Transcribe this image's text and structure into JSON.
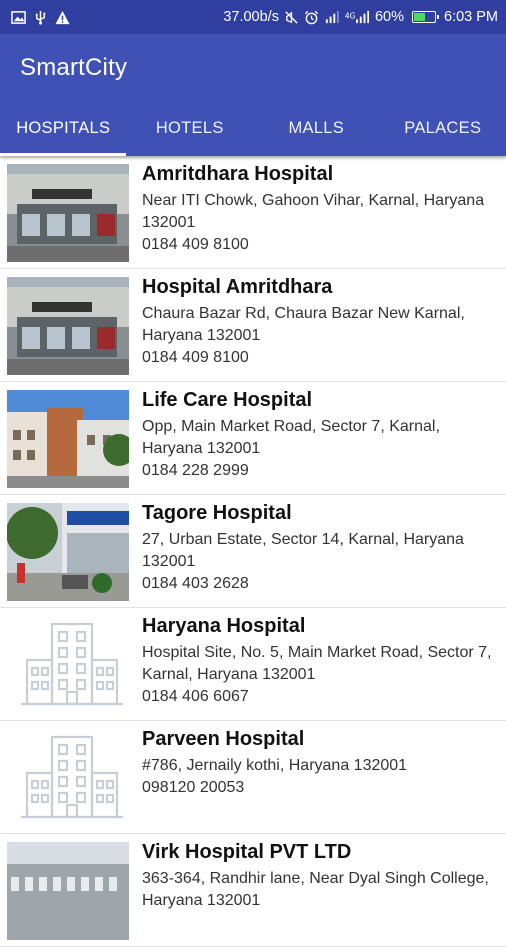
{
  "status_bar": {
    "left_icons": [
      "image-icon",
      "usb-icon",
      "warning-icon"
    ],
    "network_speed": "37.00b/s",
    "right_icons": [
      "mute-icon",
      "alarm-icon",
      "signal-icon",
      "signal-4g-icon"
    ],
    "battery_percent": "60%",
    "battery_level": 0.6,
    "time": "6:03 PM"
  },
  "app_bar": {
    "title": "SmartCity"
  },
  "tabs": [
    {
      "label": "HOSPITALS",
      "active": true
    },
    {
      "label": "HOTELS",
      "active": false
    },
    {
      "label": "MALLS",
      "active": false
    },
    {
      "label": "PALACES",
      "active": false
    }
  ],
  "hospitals": [
    {
      "name": "Amritdhara Hospital",
      "address": "Near ITI Chowk, Gahoon Vihar, Karnal, Haryana 132001",
      "phone": "0184 409 8100",
      "image": "building-photo"
    },
    {
      "name": "Hospital Amritdhara",
      "address": "Chaura Bazar Rd, Chaura Bazar New Karnal, Haryana 132001",
      "phone": "0184 409 8100",
      "image": "building-photo"
    },
    {
      "name": "Life Care Hospital",
      "address": "Opp, Main Market Road, Sector 7, Karnal, Haryana 132001",
      "phone": "0184 228 2999",
      "image": "building-photo"
    },
    {
      "name": "Tagore Hospital",
      "address": "27, Urban Estate, Sector 14, Karnal, Haryana 132001",
      "phone": "0184 403 2628",
      "image": "building-photo"
    },
    {
      "name": "Haryana Hospital",
      "address": "Hospital Site, No. 5, Main Market Road, Sector 7, Karnal, Haryana 132001",
      "phone": "0184 406 6067",
      "image": "building-placeholder-icon"
    },
    {
      "name": "Parveen Hospital",
      "address": "#786, Jernaily kothi, Haryana 132001",
      "phone": "098120 20053",
      "image": "building-placeholder-icon"
    },
    {
      "name": "Virk Hospital PVT LTD",
      "address": "363-364, Randhir lane, Near Dyal Singh College, Haryana 132001",
      "phone": "",
      "image": "building-photo"
    }
  ],
  "colors": {
    "status_bar": "#303f9f",
    "app_bar": "#3f51b5",
    "battery_fill": "#4cd964"
  }
}
